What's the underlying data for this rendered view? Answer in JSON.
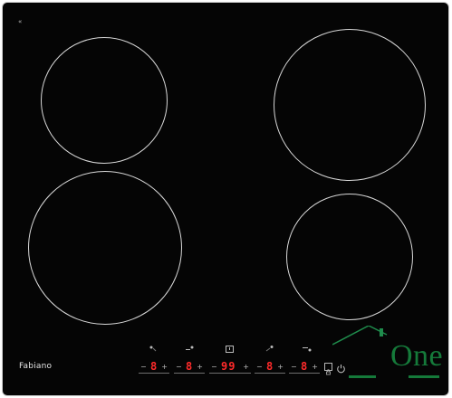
{
  "hob": {
    "brand": "Fabiano",
    "top_mark": "«",
    "lock_label_top": "",
    "lock_label_bottom": "",
    "zones": [
      {
        "name": "front-left"
      },
      {
        "name": "rear-left"
      },
      {
        "name": "front-right"
      },
      {
        "name": "rear-right"
      }
    ],
    "controls": {
      "minus": "−",
      "plus": "+",
      "sliders": [
        {
          "value": "8"
        },
        {
          "value": "8"
        },
        {
          "value": "99"
        },
        {
          "value": "8"
        },
        {
          "value": "8"
        }
      ]
    }
  },
  "logo": {
    "text": "One",
    "color": "#157a3a"
  }
}
